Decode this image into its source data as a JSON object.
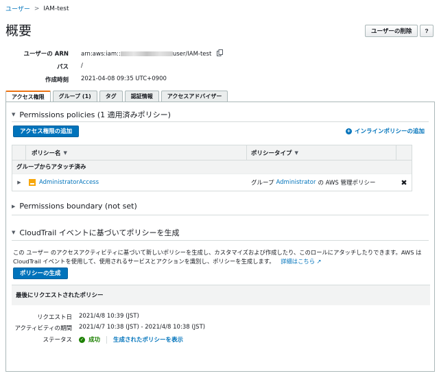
{
  "breadcrumb": {
    "parent": "ユーザー",
    "separator": ">",
    "current": "IAM-test"
  },
  "page": {
    "title": "概要",
    "delete_button": "ユーザーの削除",
    "help_button": "?"
  },
  "summary": {
    "arn_label": "ユーザーの ARN",
    "arn_prefix": "arn:aws:iam::",
    "arn_suffix": "user/IAM-test",
    "path_label": "パス",
    "path_value": "/",
    "created_label": "作成時刻",
    "created_value": "2021-04-08 09:35 UTC+0900"
  },
  "tabs": [
    {
      "label": "アクセス権限"
    },
    {
      "label": "グループ (1)"
    },
    {
      "label": "タグ"
    },
    {
      "label": "認証情報"
    },
    {
      "label": "アクセスアドバイザー"
    }
  ],
  "permissions": {
    "header": "Permissions policies (1 適用済みポリシー)",
    "add_button": "アクセス権限の追加",
    "inline_add": "インラインポリシーの追加",
    "col_name": "ポリシー名",
    "col_type": "ポリシータイプ",
    "group_label": "グループからアタッチ済み",
    "row": {
      "name": "AdministratorAccess",
      "type_prefix": "グループ",
      "type_group": "Administrator",
      "type_suffix": "の AWS 管理ポリシー"
    }
  },
  "boundary": {
    "header": "Permissions boundary (not set)"
  },
  "cloudtrail": {
    "header": "CloudTrail イベントに基づいてポリシーを生成",
    "desc": "この ユーザー のアクセスアクティビティに基づいて新しいポリシーを生成し、カスタマイズおよび作成したり、このロールにアタッチしたりできます。AWS は CloudTrail イベントを使用して、使用されるサービスとアクションを識別し、ポリシーを生成します。",
    "learn_more": "詳細はこちら",
    "generate_button": "ポリシーの生成",
    "last_request_title": "最後にリクエストされたポリシー",
    "request_date_label": "リクエスト日",
    "request_date_value": "2021/4/8 10:39 (JST)",
    "activity_label": "アクティビティの期間",
    "activity_value": "2021/4/7 10:38 (JST) - 2021/4/8 10:38 (JST)",
    "status_label": "ステータス",
    "status_value": "成功",
    "view_policy_link": "生成されたポリシーを表示"
  },
  "colors": {
    "link": "#0073bb",
    "primary": "#0073bb",
    "active_tab": "#ec7211",
    "success": "#1d8102",
    "policy_icon": "#f7a70c"
  }
}
